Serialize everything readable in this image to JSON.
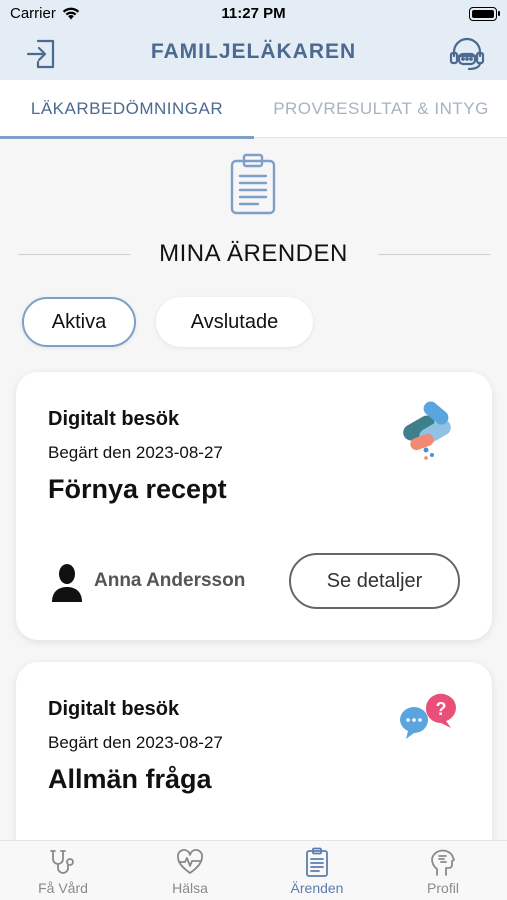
{
  "status_bar": {
    "carrier": "Carrier",
    "time": "11:27 PM"
  },
  "nav": {
    "title": "FAMILJELÄKAREN",
    "left_icon": "login-icon",
    "right_icon": "support-headset-icon"
  },
  "tabs": [
    {
      "label": "LÄKARBEDÖMNINGAR",
      "active": true
    },
    {
      "label": "PROVRESULTAT & INTYG",
      "active": false
    }
  ],
  "section": {
    "title": "MINA ÄRENDEN",
    "icon": "clipboard-icon"
  },
  "filters": [
    {
      "label": "Aktiva",
      "active": true
    },
    {
      "label": "Avslutade",
      "active": false
    }
  ],
  "cases": [
    {
      "kind": "Digitalt besök",
      "date": "Begärt den 2023-08-27",
      "subject": "Förnya recept",
      "icon": "prescription-pills-icon",
      "doctor": "Anna Andersson",
      "details_label": "Se detaljer"
    },
    {
      "kind": "Digitalt besök",
      "date": "Begärt den 2023-08-27",
      "subject": "Allmän fråga",
      "icon": "question-chat-icon"
    }
  ],
  "bottom_tabs": [
    {
      "label": "Få Vård",
      "icon": "stethoscope-icon",
      "active": false
    },
    {
      "label": "Hälsa",
      "icon": "heartbeat-icon",
      "active": false
    },
    {
      "label": "Ärenden",
      "icon": "clipboard-icon",
      "active": true
    },
    {
      "label": "Profil",
      "icon": "profile-head-icon",
      "active": false
    }
  ],
  "colors": {
    "accent": "#7e9fc7",
    "title": "#4c6a8f",
    "nav_bg": "#e4ecf5"
  }
}
